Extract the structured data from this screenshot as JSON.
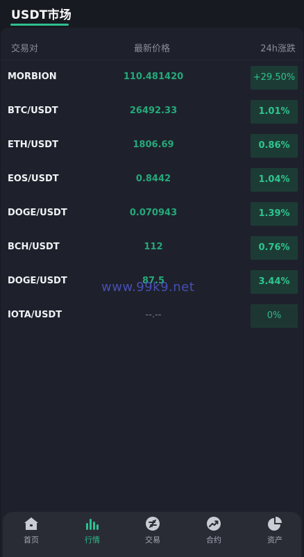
{
  "header": {
    "title": "USDT市场"
  },
  "columns": {
    "pair": "交易对",
    "price": "最新价格",
    "change": "24h涨跌"
  },
  "rows": [
    {
      "pair": "MORBION",
      "price": "110.481420",
      "change": "+29.50%"
    },
    {
      "pair": "BTC/USDT",
      "price": "26492.33",
      "change": "1.01%"
    },
    {
      "pair": "ETH/USDT",
      "price": "1806.69",
      "change": "0.86%"
    },
    {
      "pair": "EOS/USDT",
      "price": "0.8442",
      "change": "1.04%"
    },
    {
      "pair": "DOGE/USDT",
      "price": "0.070943",
      "change": "1.39%"
    },
    {
      "pair": "BCH/USDT",
      "price": "112",
      "change": "0.76%"
    },
    {
      "pair": "DOGE/USDT",
      "price": "87.5",
      "change": "3.44%"
    },
    {
      "pair": "IOTA/USDT",
      "price": "--.--",
      "change": "0%"
    }
  ],
  "watermark": "www.99k9.net",
  "bottom_nav": [
    {
      "label": "首页",
      "icon": "home-icon"
    },
    {
      "label": "行情",
      "icon": "bar-chart-icon"
    },
    {
      "label": "交易",
      "icon": "exchange-icon"
    },
    {
      "label": "合约",
      "icon": "trend-icon"
    },
    {
      "label": "资产",
      "icon": "pie-chart-icon"
    }
  ],
  "colors": {
    "accent": "#2fbf8f",
    "up": "#25a97a",
    "background": "#171a21",
    "panel": "#1e212b",
    "nav": "#292c35",
    "watermark": "#4c54c6"
  }
}
